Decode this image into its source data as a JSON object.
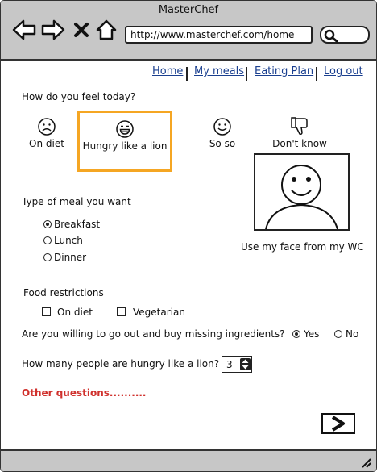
{
  "window": {
    "title": "MasterChef"
  },
  "browser": {
    "url": "http://www.masterchef.com/home"
  },
  "nav": {
    "links": [
      "Home",
      "My meals",
      "Eating Plan",
      "Log out"
    ]
  },
  "feel": {
    "question": "How do you feel today?",
    "options": [
      {
        "label": "On diet",
        "icon": "sad-face-icon"
      },
      {
        "label": "Hungry like a lion",
        "icon": "grinning-face-icon",
        "selected": true
      },
      {
        "label": "So so",
        "icon": "smiley-face-icon"
      },
      {
        "label": "Don't know",
        "icon": "thumbs-down-icon"
      }
    ],
    "highlight_color": "#f5a623"
  },
  "webcam": {
    "caption": "Use my face from my WC"
  },
  "meal": {
    "question": "Type of meal you want",
    "options": [
      "Breakfast",
      "Lunch",
      "Dinner"
    ],
    "selected": "Breakfast"
  },
  "restrictions": {
    "label": "Food restrictions",
    "options": [
      "On diet",
      "Vegetarian"
    ]
  },
  "buy": {
    "question": "Are you willing to go out and buy missing ingredients?",
    "options": [
      "Yes",
      "No"
    ],
    "selected": "Yes"
  },
  "people": {
    "question": "How many people are hungry like a lion?",
    "value": "3"
  },
  "other": {
    "label": "Other questions..........",
    "color": "#d0312d"
  },
  "colors": {
    "chrome": "#c7c7c7",
    "link": "#1a3f8f"
  }
}
